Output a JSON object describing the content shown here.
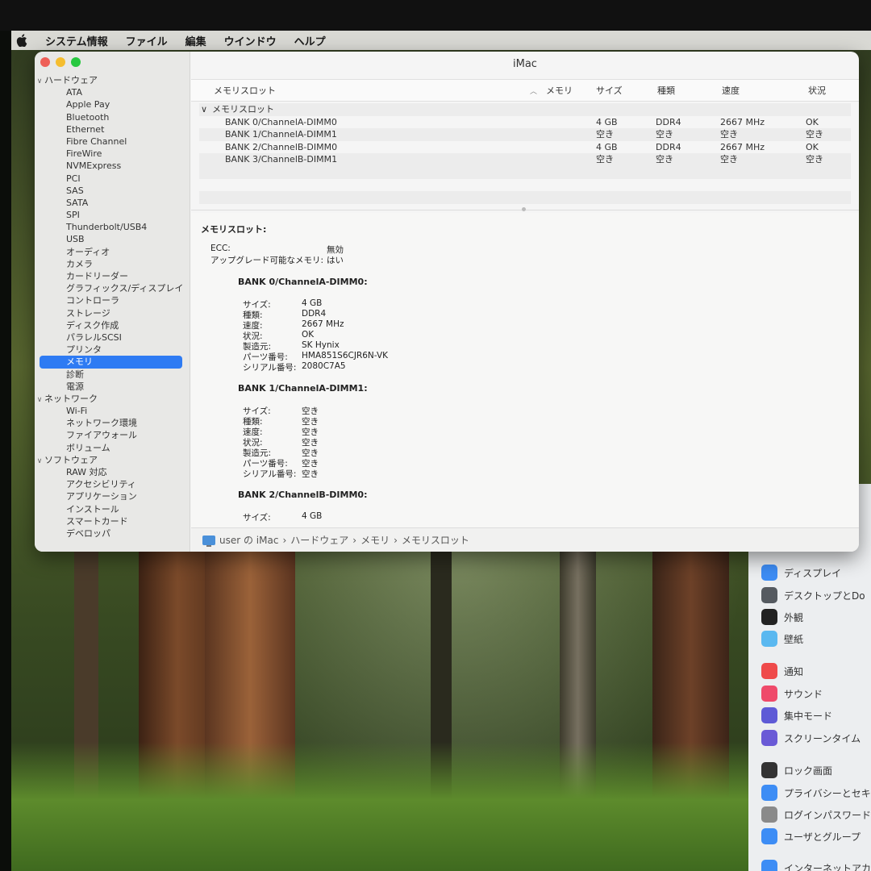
{
  "menubar": {
    "app_name": "システム情報",
    "items": [
      "ファイル",
      "編集",
      "ウインドウ",
      "ヘルプ"
    ]
  },
  "window": {
    "title": "iMac",
    "sidebar": [
      {
        "label": "ハードウェア",
        "level": 0,
        "expanded": true
      },
      {
        "label": "ATA",
        "level": 1
      },
      {
        "label": "Apple Pay",
        "level": 1
      },
      {
        "label": "Bluetooth",
        "level": 1
      },
      {
        "label": "Ethernet",
        "level": 1
      },
      {
        "label": "Fibre Channel",
        "level": 1
      },
      {
        "label": "FireWire",
        "level": 1
      },
      {
        "label": "NVMExpress",
        "level": 1
      },
      {
        "label": "PCI",
        "level": 1
      },
      {
        "label": "SAS",
        "level": 1
      },
      {
        "label": "SATA",
        "level": 1
      },
      {
        "label": "SPI",
        "level": 1
      },
      {
        "label": "Thunderbolt/USB4",
        "level": 1
      },
      {
        "label": "USB",
        "level": 1
      },
      {
        "label": "オーディオ",
        "level": 1
      },
      {
        "label": "カメラ",
        "level": 1
      },
      {
        "label": "カードリーダー",
        "level": 1
      },
      {
        "label": "グラフィックス/ディスプレイ",
        "level": 1
      },
      {
        "label": "コントローラ",
        "level": 1
      },
      {
        "label": "ストレージ",
        "level": 1
      },
      {
        "label": "ディスク作成",
        "level": 1
      },
      {
        "label": "パラレルSCSI",
        "level": 1
      },
      {
        "label": "プリンタ",
        "level": 1
      },
      {
        "label": "メモリ",
        "level": 1,
        "selected": true
      },
      {
        "label": "診断",
        "level": 1
      },
      {
        "label": "電源",
        "level": 1
      },
      {
        "label": "ネットワーク",
        "level": 0,
        "expanded": true
      },
      {
        "label": "Wi-Fi",
        "level": 1
      },
      {
        "label": "ネットワーク環境",
        "level": 1
      },
      {
        "label": "ファイアウォール",
        "level": 1
      },
      {
        "label": "ボリューム",
        "level": 1
      },
      {
        "label": "ソフトウェア",
        "level": 0,
        "expanded": true
      },
      {
        "label": "RAW 対応",
        "level": 1
      },
      {
        "label": "アクセシビリティ",
        "level": 1
      },
      {
        "label": "アプリケーション",
        "level": 1
      },
      {
        "label": "インストール",
        "level": 1
      },
      {
        "label": "スマートカード",
        "level": 1
      },
      {
        "label": "デベロッパ",
        "level": 1
      }
    ],
    "table": {
      "columns": [
        "メモリスロット",
        "メモリ",
        "サイズ",
        "種類",
        "速度",
        "状況"
      ],
      "group_label": "メモリスロット",
      "rows": [
        {
          "slot": "BANK 0/ChannelA-DIMM0",
          "size": "4 GB",
          "type": "DDR4",
          "speed": "2667 MHz",
          "status": "OK"
        },
        {
          "slot": "BANK 1/ChannelA-DIMM1",
          "size": "空き",
          "type": "空き",
          "speed": "空き",
          "status": "空き"
        },
        {
          "slot": "BANK 2/ChannelB-DIMM0",
          "size": "4 GB",
          "type": "DDR4",
          "speed": "2667 MHz",
          "status": "OK"
        },
        {
          "slot": "BANK 3/ChannelB-DIMM1",
          "size": "空き",
          "type": "空き",
          "speed": "空き",
          "status": "空き"
        }
      ]
    },
    "detail": {
      "title": "メモリスロット:",
      "ecc_label": "ECC:",
      "ecc_value": "無効",
      "upgrade_label": "アップグレード可能なメモリ:",
      "upgrade_value": "はい",
      "banks": [
        {
          "title": "BANK 0/ChannelA-DIMM0:",
          "fields": [
            {
              "k": "サイズ:",
              "v": "4 GB"
            },
            {
              "k": "種類:",
              "v": "DDR4"
            },
            {
              "k": "速度:",
              "v": "2667 MHz"
            },
            {
              "k": "状況:",
              "v": "OK"
            },
            {
              "k": "製造元:",
              "v": "SK Hynix"
            },
            {
              "k": "パーツ番号:",
              "v": "HMA851S6CJR6N-VK"
            },
            {
              "k": "シリアル番号:",
              "v": "2080C7A5"
            }
          ]
        },
        {
          "title": "BANK 1/ChannelA-DIMM1:",
          "fields": [
            {
              "k": "サイズ:",
              "v": "空き"
            },
            {
              "k": "種類:",
              "v": "空き"
            },
            {
              "k": "速度:",
              "v": "空き"
            },
            {
              "k": "状況:",
              "v": "空き"
            },
            {
              "k": "製造元:",
              "v": "空き"
            },
            {
              "k": "パーツ番号:",
              "v": "空き"
            },
            {
              "k": "シリアル番号:",
              "v": "空き"
            }
          ]
        },
        {
          "title": "BANK 2/ChannelB-DIMM0:",
          "fields": [
            {
              "k": "サイズ:",
              "v": "4 GB"
            }
          ]
        }
      ]
    },
    "pathbar": [
      "user の iMac",
      "ハードウェア",
      "メモリ",
      "メモリスロット"
    ]
  },
  "settings_panel": {
    "items": [
      {
        "label": "ディスプレイ",
        "color": "#3d8df5"
      },
      {
        "label": "デスクトップとDo",
        "color": "#555a60"
      },
      {
        "label": "外観",
        "color": "#222222"
      },
      {
        "label": "壁紙",
        "color": "#5ab8f0"
      },
      {
        "label": "通知",
        "color": "#ef4a4a"
      },
      {
        "label": "サウンド",
        "color": "#ef4a6a"
      },
      {
        "label": "集中モード",
        "color": "#5e5ad6"
      },
      {
        "label": "スクリーンタイム",
        "color": "#6a5ad6"
      },
      {
        "label": "ロック画面",
        "color": "#333333"
      },
      {
        "label": "プライバシーとセキ",
        "color": "#3d8df5"
      },
      {
        "label": "ログインパスワード",
        "color": "#8a8a8a"
      },
      {
        "label": "ユーザとグループ",
        "color": "#3d8df5"
      },
      {
        "label": "インターネットアカ",
        "color": "#3d8df5"
      }
    ]
  }
}
